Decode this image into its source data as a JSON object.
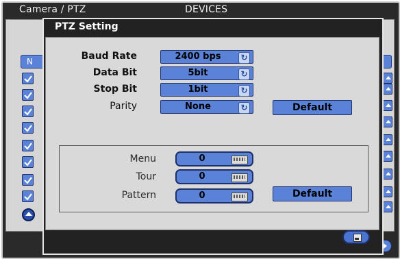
{
  "background": {
    "title_left": "Camera / PTZ",
    "title_center": "DEVICES",
    "header_button_label": "N"
  },
  "dialog": {
    "title": "PTZ Setting",
    "serial": {
      "baud_rate_label": "Baud Rate",
      "baud_rate_value": "2400 bps",
      "data_bit_label": "Data Bit",
      "data_bit_value": "5bit",
      "stop_bit_label": "Stop Bit",
      "stop_bit_value": "1bit",
      "parity_label": "Parity",
      "parity_value": "None",
      "default_label": "Default"
    },
    "presets": {
      "menu_label": "Menu",
      "menu_value": "0",
      "tour_label": "Tour",
      "tour_value": "0",
      "pattern_label": "Pattern",
      "pattern_value": "0",
      "default_label": "Default"
    }
  },
  "colors": {
    "accent": "#5a82d6",
    "window_bg": "#222222",
    "panel_bg": "#d9d9d9"
  }
}
